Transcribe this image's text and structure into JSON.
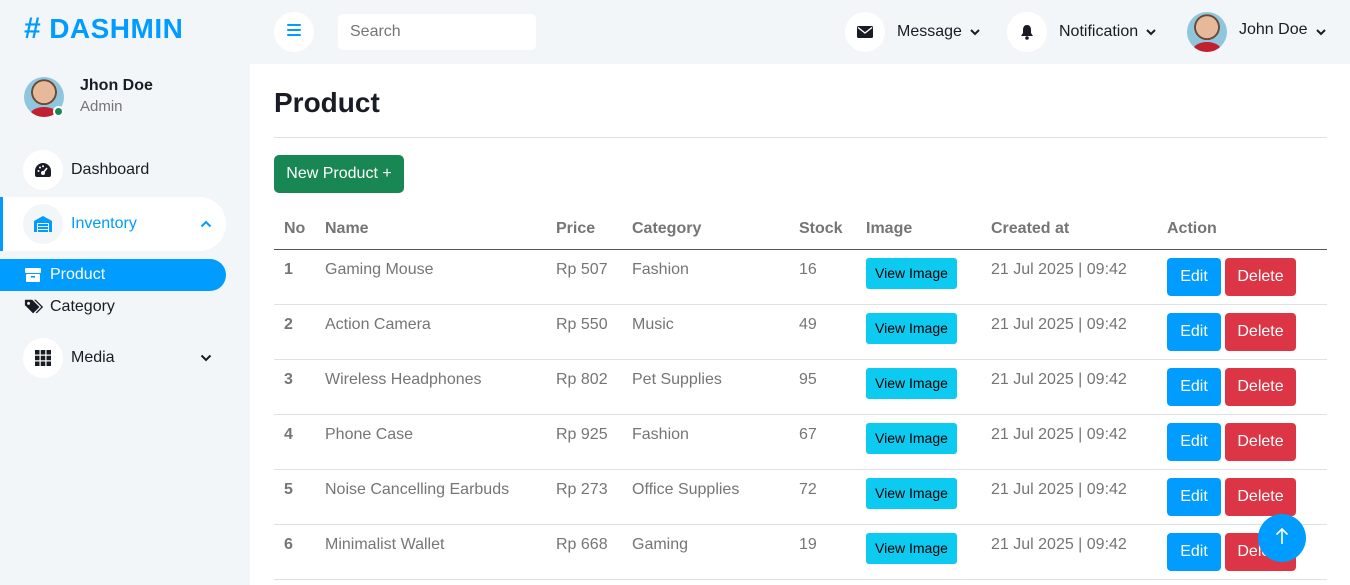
{
  "brand": {
    "name": "DASHMIN",
    "hash": "#"
  },
  "profile": {
    "name": "Jhon Doe",
    "role": "Admin"
  },
  "sidebar": {
    "items": [
      {
        "label": "Dashboard",
        "icon": "gauge-icon"
      },
      {
        "label": "Inventory",
        "icon": "warehouse-icon",
        "active": true,
        "expanded": true
      },
      {
        "label": "Media",
        "icon": "grid-icon"
      }
    ],
    "submenu": [
      {
        "label": "Product",
        "icon": "box-icon",
        "active": true
      },
      {
        "label": "Category",
        "icon": "tags-icon"
      }
    ]
  },
  "topbar": {
    "search_placeholder": "Search",
    "message_label": "Message",
    "notification_label": "Notification",
    "user_name": "John Doe"
  },
  "main": {
    "title": "Product",
    "new_button": "New Product +",
    "columns": [
      "No",
      "Name",
      "Price",
      "Category",
      "Stock",
      "Image",
      "Created at",
      "Action"
    ],
    "rows": [
      {
        "no": "1",
        "name": "Gaming Mouse",
        "price": "Rp 507",
        "category": "Fashion",
        "stock": "16",
        "created": "21 Jul 2025 | 09:42"
      },
      {
        "no": "2",
        "name": "Action Camera",
        "price": "Rp 550",
        "category": "Music",
        "stock": "49",
        "created": "21 Jul 2025 | 09:42"
      },
      {
        "no": "3",
        "name": "Wireless Headphones",
        "price": "Rp 802",
        "category": "Pet Supplies",
        "stock": "95",
        "created": "21 Jul 2025 | 09:42"
      },
      {
        "no": "4",
        "name": "Phone Case",
        "price": "Rp 925",
        "category": "Fashion",
        "stock": "67",
        "created": "21 Jul 2025 | 09:42"
      },
      {
        "no": "5",
        "name": "Noise Cancelling Earbuds",
        "price": "Rp 273",
        "category": "Office Supplies",
        "stock": "72",
        "created": "21 Jul 2025 | 09:42"
      },
      {
        "no": "6",
        "name": "Minimalist Wallet",
        "price": "Rp 668",
        "category": "Gaming",
        "stock": "19",
        "created": "21 Jul 2025 | 09:42"
      }
    ],
    "view_label": "View Image",
    "edit_label": "Edit",
    "delete_label": "Delete"
  },
  "colors": {
    "primary": "#009CFF",
    "success": "#198754",
    "info": "#0DCAF0",
    "danger": "#dc3545",
    "light": "#F3F6F9",
    "dark": "#191C24"
  }
}
